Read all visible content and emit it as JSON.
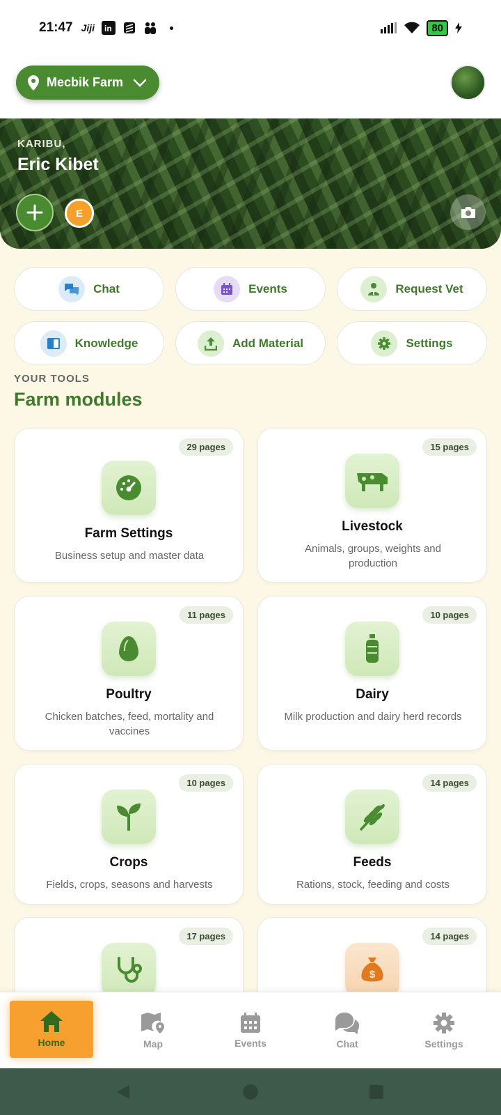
{
  "status_bar": {
    "time": "21:47",
    "notification_app": "Jiji",
    "battery": "80"
  },
  "header": {
    "farm_name": "Mecbik Farm"
  },
  "hero": {
    "greeting": "KARIBU,",
    "user_name": "Eric Kibet",
    "user_initial": "E"
  },
  "quick_actions": [
    {
      "label": "Chat",
      "icon": "chat-bubbles-icon",
      "color": "#2a7fc9"
    },
    {
      "label": "Events",
      "icon": "calendar-icon",
      "color": "#7a55c9"
    },
    {
      "label": "Request Vet",
      "icon": "vet-person-icon",
      "color": "#4a8b32"
    },
    {
      "label": "Knowledge",
      "icon": "book-icon",
      "color": "#2a7fc9"
    },
    {
      "label": "Add Material",
      "icon": "upload-icon",
      "color": "#4a8b32"
    },
    {
      "label": "Settings",
      "icon": "gear-icon",
      "color": "#4a8b32"
    }
  ],
  "section": {
    "kicker": "YOUR TOOLS",
    "title": "Farm modules"
  },
  "modules": [
    {
      "title": "Farm Settings",
      "description": "Business setup and master data",
      "pages": "29 pages",
      "icon": "dashboard-gauge-icon"
    },
    {
      "title": "Livestock",
      "description": "Animals, groups, weights and production",
      "pages": "15 pages",
      "icon": "cow-icon"
    },
    {
      "title": "Poultry",
      "description": "Chicken batches, feed, mortality and vaccines",
      "pages": "11 pages",
      "icon": "egg-icon"
    },
    {
      "title": "Dairy",
      "description": "Milk production and dairy herd records",
      "pages": "10 pages",
      "icon": "milk-bottle-icon"
    },
    {
      "title": "Crops",
      "description": "Fields, crops, seasons and harvests",
      "pages": "10 pages",
      "icon": "seedling-icon"
    },
    {
      "title": "Feeds",
      "description": "Rations, stock, feeding and costs",
      "pages": "14 pages",
      "icon": "wheat-icon"
    },
    {
      "title": "",
      "description": "",
      "pages": "17 pages",
      "icon": "stethoscope-icon"
    },
    {
      "title": "",
      "description": "",
      "pages": "14 pages",
      "icon": "money-bag-icon"
    }
  ],
  "bottom_nav": [
    {
      "label": "Home",
      "icon": "home-icon",
      "active": true
    },
    {
      "label": "Map",
      "icon": "map-icon",
      "active": false
    },
    {
      "label": "Events",
      "icon": "calendar-icon",
      "active": false
    },
    {
      "label": "Chat",
      "icon": "chat-bubbles-icon",
      "active": false
    },
    {
      "label": "Settings",
      "icon": "gear-icon",
      "active": false
    }
  ],
  "colors": {
    "brand_green": "#4a8b32",
    "accent_orange": "#f7a030",
    "background": "#fdf8e6"
  }
}
